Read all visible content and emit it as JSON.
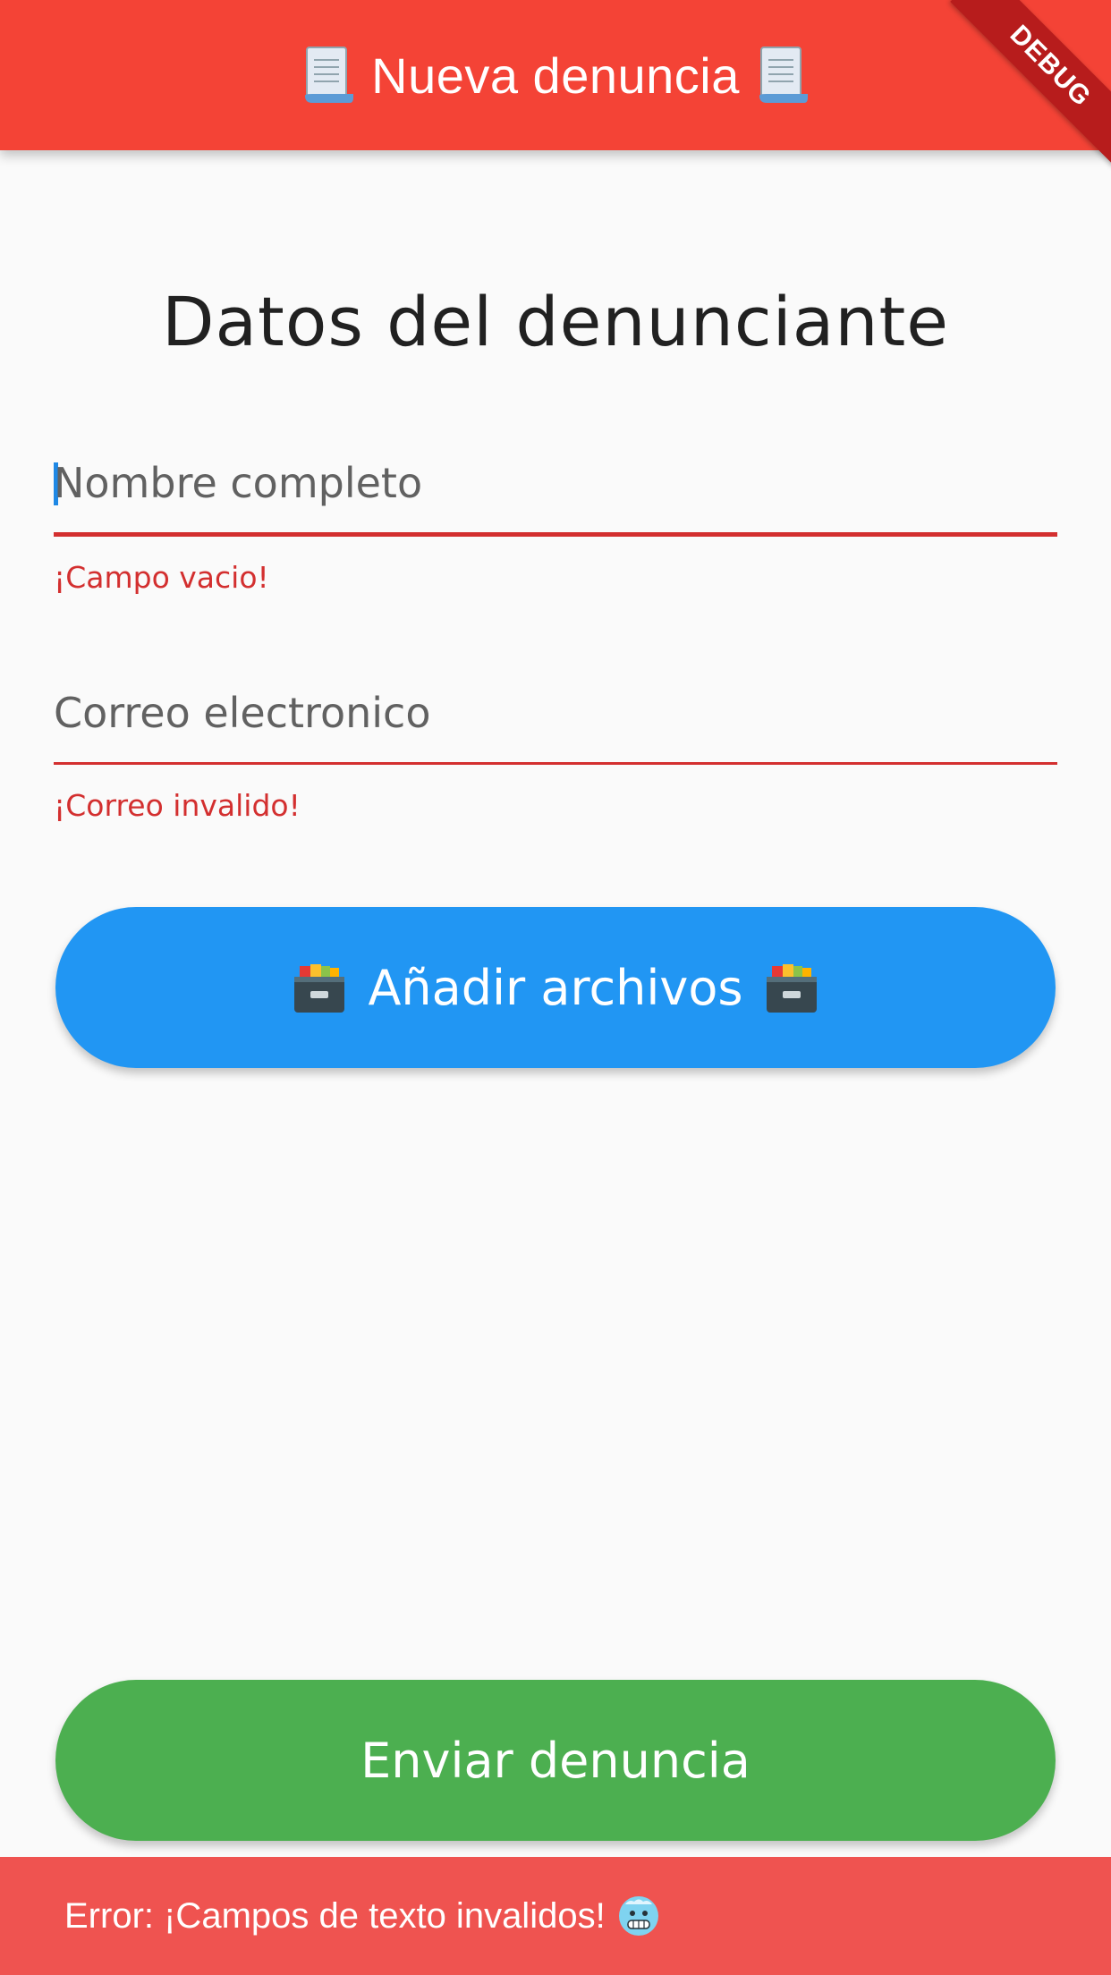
{
  "appbar": {
    "title": "Nueva denuncia",
    "icon": "scroll-icon",
    "color": "#f44336"
  },
  "debug_banner": {
    "label": "DEBUG"
  },
  "form": {
    "heading": "Datos del denunciante",
    "name_field": {
      "placeholder": "Nombre completo",
      "error": "¡Campo vacio!"
    },
    "email_field": {
      "placeholder": "Correo electronico",
      "error": "¡Correo invalido!"
    },
    "error_color": "#d32f2f"
  },
  "buttons": {
    "add_files": {
      "label": "Añadir archivos",
      "icon": "file-cabinet-icon",
      "color": "#2196f3"
    },
    "submit": {
      "label": "Enviar denuncia",
      "color": "#4caf50"
    }
  },
  "snackbar": {
    "message": "Error: ¡Campos de texto invalidos!",
    "icon": "cold-face-icon",
    "color": "#ef5350"
  }
}
